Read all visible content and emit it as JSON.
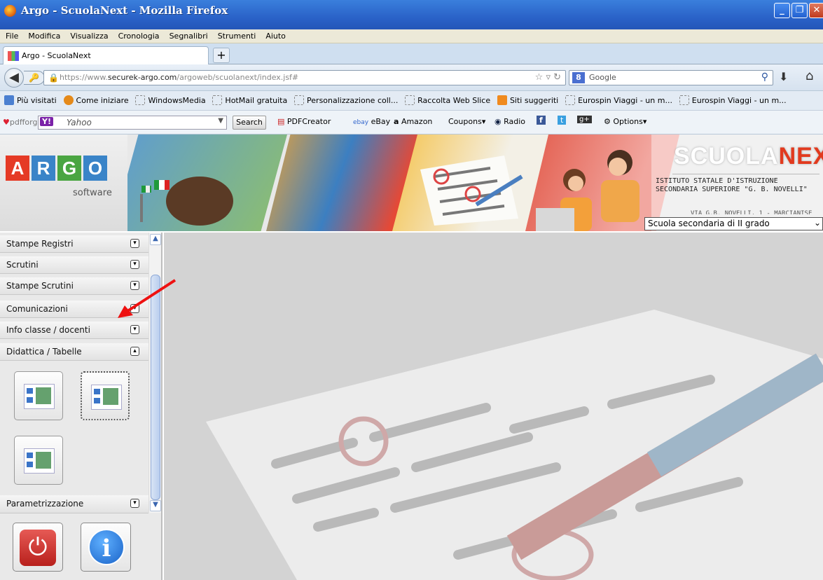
{
  "window": {
    "title": "Argo - ScuolaNext - Mozilla Firefox"
  },
  "menu": [
    "File",
    "Modifica",
    "Visualizza",
    "Cronologia",
    "Segnalibri",
    "Strumenti",
    "Aiuto"
  ],
  "tab": {
    "label": "Argo - ScuolaNext",
    "new_tab": "+"
  },
  "nav": {
    "url_scheme": "https://www.",
    "url_host": "securek-argo.com",
    "url_path": "/argoweb/scuolanext/index.jsf#",
    "search_engine": "Google"
  },
  "bookmarks": [
    "Più visitati",
    "Come iniziare",
    "WindowsMedia",
    "HotMail gratuita",
    "Personalizzazione coll...",
    "Raccolta Web Slice",
    "Siti suggeriti",
    "Eurospin Viaggi - un m...",
    "Eurospin Viaggi - un m..."
  ],
  "toolbar": {
    "pdfforge": "pdfforge",
    "yahoo_placeholder": "Yahoo",
    "search_button": "Search",
    "items": [
      "PDFCreator",
      "eBay",
      "Amazon",
      "Coupons",
      "Radio",
      "Options"
    ]
  },
  "banner": {
    "logo_letters": [
      "A",
      "R",
      "G",
      "O"
    ],
    "logo_colors": [
      "#e53a25",
      "#3a84c8",
      "#4aa542",
      "#3a84c8"
    ],
    "logo_sub": "software",
    "brand_a": "SCUOLA",
    "brand_b": "NEXT",
    "institute": "ISTITUTO STATALE D'ISTRUZIONE SECONDARIA SUPERIORE \"G. B. NOVELLI\"",
    "address": "VIA G.B. NOVELLI, 1 - MARCIANISE",
    "grado": "Scuola secondaria di II grado"
  },
  "sidebar": {
    "sections": [
      "Stampe Registri",
      "Scrutini",
      "Stampe Scrutini",
      "Comunicazioni",
      "Info classe / docenti",
      "Didattica / Tabelle"
    ],
    "parametrizzazione": "Parametrizzazione"
  }
}
